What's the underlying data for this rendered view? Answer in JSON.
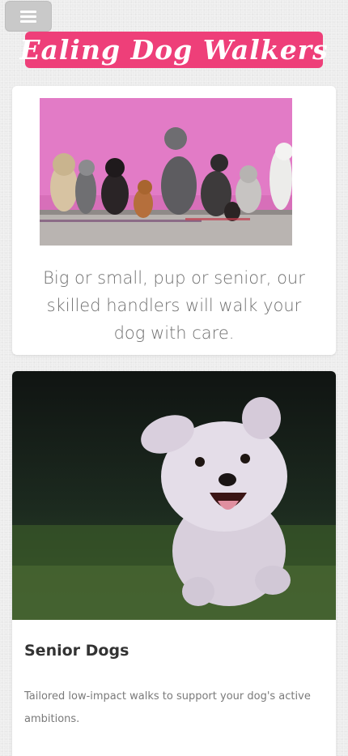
{
  "header": {
    "menu_icon": "hamburger-icon",
    "brand_name": "Ealing Dog Walkers",
    "brand_color": "#ee3f79"
  },
  "intro_card": {
    "image_subject": "dogs-in-a-row-against-pink-wall",
    "text": "Big or small, pup or senior, our skilled handlers will walk your dog with care."
  },
  "service_card": {
    "image_subject": "fluffy-dog-running-on-grass",
    "title": "Senior Dogs",
    "description": "Tailored low-impact walks to support your dog's active ambitions."
  }
}
